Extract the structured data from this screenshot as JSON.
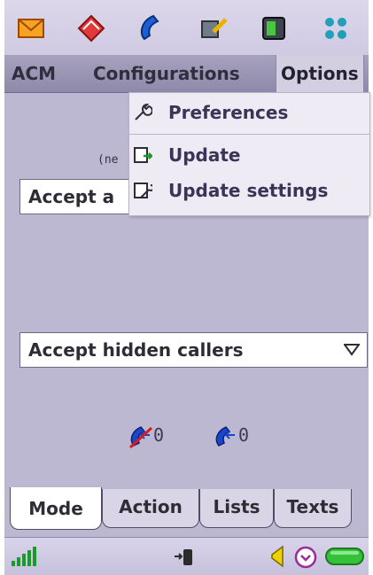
{
  "top_icons": [
    "envelope-icon",
    "book-icon",
    "phone-handset-icon",
    "tools-icon",
    "sim-card-icon",
    "apps-grid-icon"
  ],
  "menubar": {
    "items": [
      "ACM",
      "Configurations",
      "Options"
    ],
    "active": "Options"
  },
  "options_menu": {
    "items": [
      {
        "label": "Preferences",
        "icon": "wrench-icon"
      },
      {
        "label": "Update",
        "icon": "update-icon"
      },
      {
        "label": "Update settings",
        "icon": "update-settings-icon"
      }
    ]
  },
  "content": {
    "partial_label": "(ne",
    "dropdown_top": {
      "value": "Accept a"
    },
    "dropdown_hidden": {
      "value": "Accept hidden callers"
    },
    "rejected_count": "0",
    "accepted_count": "0"
  },
  "tabs": [
    {
      "label": "Mode",
      "active": true
    },
    {
      "label": "Action",
      "active": false
    },
    {
      "label": "Lists",
      "active": false
    },
    {
      "label": "Texts",
      "active": false
    }
  ],
  "status_icons": [
    "signal-strength-icon",
    "phone-activity-icon",
    "volume-icon",
    "alarm-clock-icon",
    "battery-icon"
  ],
  "colors": {
    "accent": "#d3cfe1",
    "content_bg": "#bdb8d1",
    "menubar_bg": "#9c97b6",
    "battery": "#35c23a"
  }
}
